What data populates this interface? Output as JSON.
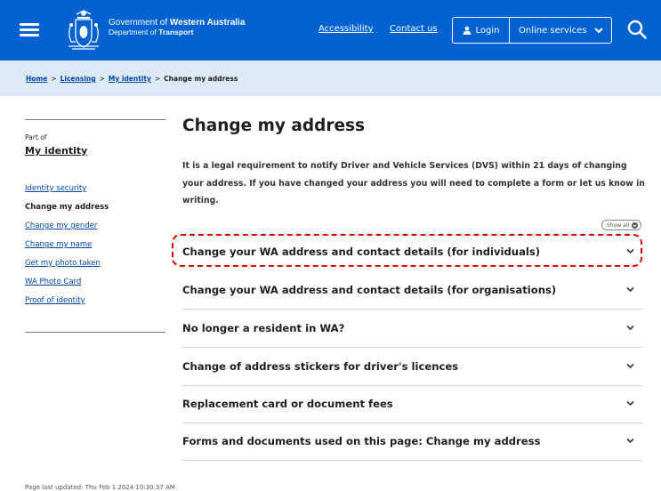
{
  "header": {
    "brand_prefix": "Government of ",
    "brand_emph": "Western Australia",
    "dept_prefix": "Department of ",
    "dept_emph": "Transport",
    "accessibility": "Accessibility",
    "contact": "Contact us",
    "login": "Login",
    "online_services": "Online services",
    "bg_color": "#0062d1"
  },
  "breadcrumb": {
    "items": [
      "Home",
      "Licensing",
      "My identity"
    ],
    "separator": ">",
    "current": "Change my address"
  },
  "sidebar": {
    "part_of": "Part of",
    "title": "My identity",
    "items": [
      "Identity security",
      "Change my address",
      "Change my gender",
      "Change my name",
      "Get my photo taken",
      "WA Photo Card",
      "Proof of identity"
    ],
    "active_index": 1
  },
  "main": {
    "title": "Change my address",
    "intro": "It is a legal requirement to notify Driver and Vehicle Services (DVS) within 21 days of changing your address. If you have changed your address you will need to complete a form or let us know in writing.",
    "show_all": "Show all",
    "accordion": [
      "Change your WA address and contact details (for individuals)",
      "Change your WA address and contact details (for organisations)",
      "No longer a resident in WA?",
      "Change of address stickers for driver's licences",
      "Replacement card or document fees",
      "Forms and documents used on this page: Change my address"
    ],
    "highlight_color": "#e00000"
  },
  "footer": {
    "last_updated": "Page last updated: Thu Feb 1 2024 10:30:37 AM"
  }
}
